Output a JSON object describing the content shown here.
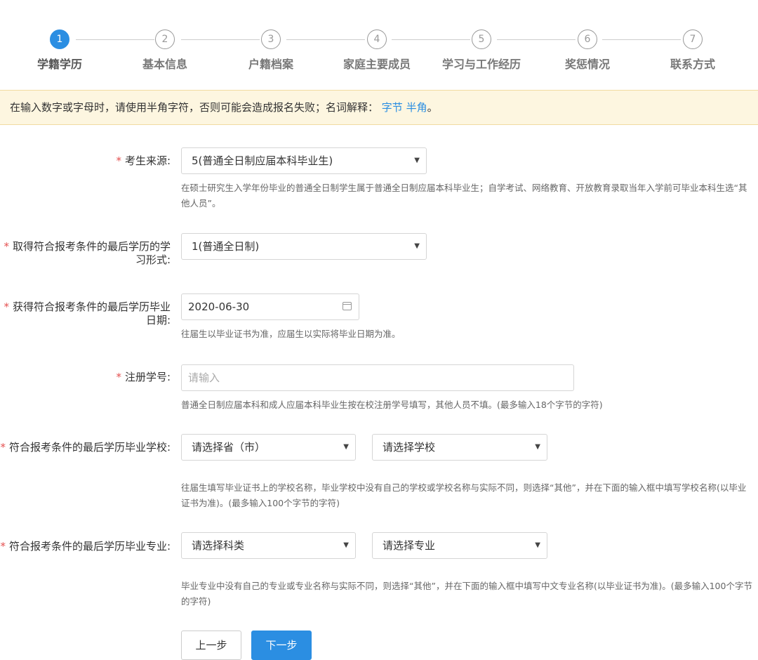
{
  "steps": [
    {
      "num": "1",
      "label": "学籍学历",
      "active": true
    },
    {
      "num": "2",
      "label": "基本信息",
      "active": false
    },
    {
      "num": "3",
      "label": "户籍档案",
      "active": false
    },
    {
      "num": "4",
      "label": "家庭主要成员",
      "active": false
    },
    {
      "num": "5",
      "label": "学习与工作经历",
      "active": false
    },
    {
      "num": "6",
      "label": "奖惩情况",
      "active": false
    },
    {
      "num": "7",
      "label": "联系方式",
      "active": false
    }
  ],
  "notice": {
    "text": "在输入数字或字母时，请使用半角字符，否则可能会造成报名失败；名词解释：",
    "link1": "字节",
    "link2": "半角",
    "end": "。"
  },
  "form": {
    "required_mark": "*",
    "source": {
      "label": "考生来源:",
      "value": "5(普通全日制应届本科毕业生)",
      "help": "在硕士研究生入学年份毕业的普通全日制学生属于普通全日制应届本科毕业生；自学考试、网络教育、开放教育录取当年入学前可毕业本科生选“其他人员”。"
    },
    "study_form": {
      "label": "取得符合报考条件的最后学历的学习形式:",
      "value": "1(普通全日制)"
    },
    "grad_date": {
      "label": "获得符合报考条件的最后学历毕业日期:",
      "value": "2020-06-30",
      "help": "往届生以毕业证书为准，应届生以实际将毕业日期为准。"
    },
    "student_id": {
      "label": "注册学号:",
      "placeholder": "请输入",
      "help": "普通全日制应届本科和成人应届本科毕业生按在校注册学号填写，其他人员不填。(最多输入18个字节的字符)"
    },
    "school": {
      "label": "符合报考条件的最后学历毕业学校:",
      "province": "请选择省（市）",
      "school": "请选择学校",
      "help": "往届生填写毕业证书上的学校名称，毕业学校中没有自己的学校或学校名称与实际不同，则选择“其他”，并在下面的输入框中填写学校名称(以毕业证书为准)。(最多输入100个字节的字符)"
    },
    "major": {
      "label": "符合报考条件的最后学历毕业专业:",
      "category": "请选择科类",
      "major": "请选择专业",
      "help": "毕业专业中没有自己的专业或专业名称与实际不同，则选择“其他”，并在下面的输入框中填写中文专业名称(以毕业证书为准)。(最多输入100个字节的字符)"
    }
  },
  "buttons": {
    "prev": "上一步",
    "next": "下一步"
  },
  "colors": {
    "primary": "#2b8ee2",
    "notice_bg": "#fdf6e0",
    "required": "#e45050"
  },
  "icons": {
    "caret": "▼",
    "calendar": "calendar-icon"
  }
}
